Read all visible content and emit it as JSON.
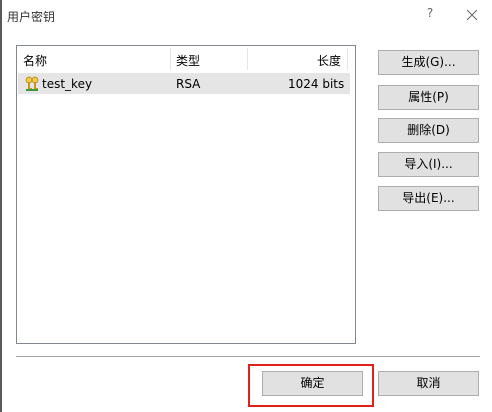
{
  "window": {
    "title": "用户密钥",
    "help_label": "?"
  },
  "list": {
    "columns": [
      "名称",
      "类型",
      "长度"
    ],
    "rows": [
      {
        "name": "test_key",
        "type": "RSA",
        "length": "1024 bits"
      }
    ]
  },
  "side_buttons": {
    "generate": "生成(G)...",
    "properties": "属性(P)",
    "delete": "删除(D)",
    "import": "导入(I)...",
    "export": "导出(E)..."
  },
  "footer": {
    "ok": "确定",
    "cancel": "取消"
  },
  "colors": {
    "selected_row": "#e5e5e5",
    "highlight_box": "#e0201b",
    "button_face": "#e1e1e1"
  },
  "icons": {
    "key": "key-pair-icon",
    "close": "close-icon"
  }
}
